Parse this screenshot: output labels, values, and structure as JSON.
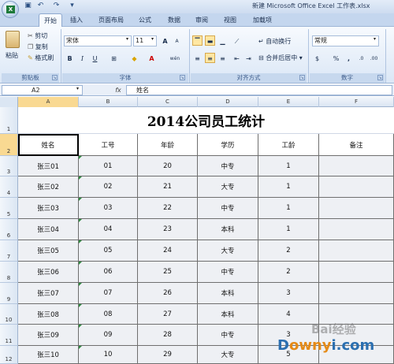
{
  "window": {
    "title": "新建 Microsoft Office Excel 工作表.xlsx"
  },
  "tabs": [
    "开始",
    "插入",
    "页面布局",
    "公式",
    "数据",
    "审阅",
    "视图",
    "加载项"
  ],
  "ribbon": {
    "clipboard": {
      "paste": "粘贴",
      "cut": "剪切",
      "copy": "复制",
      "format_painter": "格式刷",
      "label": "剪贴板"
    },
    "font": {
      "name": "宋体",
      "size": "11",
      "grow": "A",
      "shrink": "A",
      "bold": "B",
      "italic": "I",
      "underline": "U",
      "label": "字体",
      "phonetic": "wén"
    },
    "alignment": {
      "wrap": "自动换行",
      "merge": "合并后居中",
      "label": "对齐方式"
    },
    "number": {
      "format": "常规",
      "percent": "%",
      "comma": ",",
      "label": "数字",
      "currency": "$"
    }
  },
  "formula_bar": {
    "name_box": "A2",
    "fx": "fx",
    "value": "姓名"
  },
  "columns": [
    "A",
    "B",
    "C",
    "D",
    "E",
    "F"
  ],
  "rows": [
    "1",
    "2",
    "3",
    "4",
    "5",
    "6",
    "7",
    "8",
    "9",
    "10",
    "11",
    "12"
  ],
  "sheet": {
    "title": "2014公司员工统计",
    "headers": [
      "姓名",
      "工号",
      "年龄",
      "学历",
      "工龄",
      "备注"
    ],
    "data": [
      [
        "张三01",
        "01",
        "20",
        "中专",
        "1",
        ""
      ],
      [
        "张三02",
        "02",
        "21",
        "大专",
        "1",
        ""
      ],
      [
        "张三03",
        "03",
        "22",
        "中专",
        "1",
        ""
      ],
      [
        "张三04",
        "04",
        "23",
        "本科",
        "1",
        ""
      ],
      [
        "张三05",
        "05",
        "24",
        "大专",
        "2",
        ""
      ],
      [
        "张三06",
        "06",
        "25",
        "中专",
        "2",
        ""
      ],
      [
        "张三07",
        "07",
        "26",
        "本科",
        "3",
        ""
      ],
      [
        "张三08",
        "08",
        "27",
        "本科",
        "4",
        ""
      ],
      [
        "张三09",
        "09",
        "28",
        "中专",
        "3",
        ""
      ],
      [
        "张三10",
        "10",
        "29",
        "大专",
        "5",
        ""
      ]
    ]
  },
  "watermark": {
    "line1": "Bai经验",
    "line2_a": "D",
    "line2_b": "owny",
    "line2_c": "i.com"
  }
}
